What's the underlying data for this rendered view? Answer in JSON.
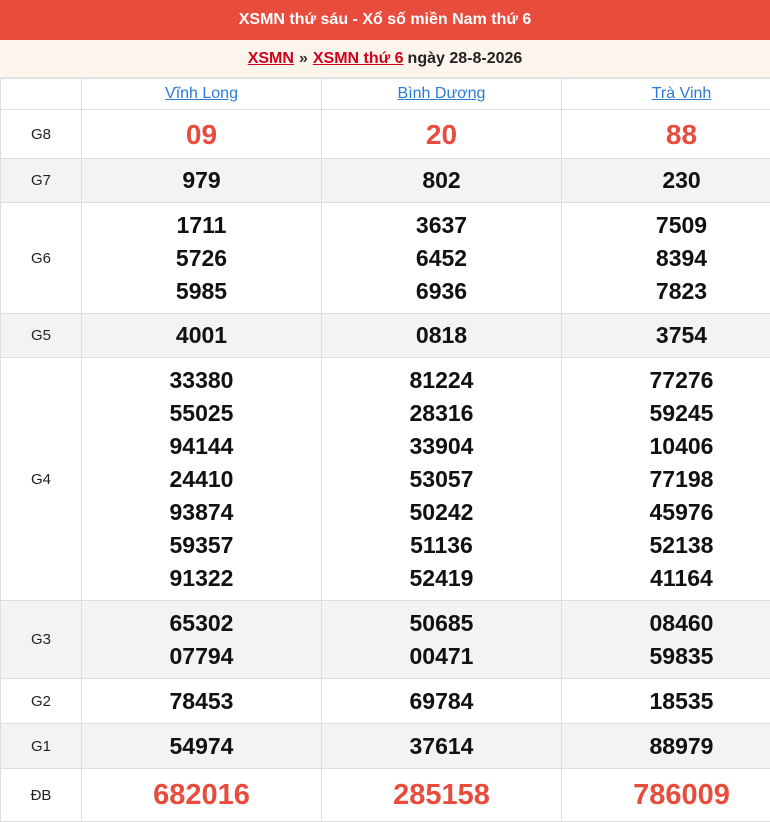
{
  "header": {
    "title": "XSMN thứ sáu - Xổ số miền Nam thứ 6"
  },
  "breadcrumb": {
    "link1": "XSMN",
    "separator": "»",
    "link2": "XSMN thứ 6",
    "date_text": "ngày 28-8-2026"
  },
  "provinces": [
    "Vĩnh Long",
    "Bình Dương",
    "Trà Vinh"
  ],
  "prizes": {
    "g8": {
      "label": "G8",
      "values": [
        [
          "09"
        ],
        [
          "20"
        ],
        [
          "88"
        ]
      ]
    },
    "g7": {
      "label": "G7",
      "values": [
        [
          "979"
        ],
        [
          "802"
        ],
        [
          "230"
        ]
      ]
    },
    "g6": {
      "label": "G6",
      "values": [
        [
          "1711",
          "5726",
          "5985"
        ],
        [
          "3637",
          "6452",
          "6936"
        ],
        [
          "7509",
          "8394",
          "7823"
        ]
      ]
    },
    "g5": {
      "label": "G5",
      "values": [
        [
          "4001"
        ],
        [
          "0818"
        ],
        [
          "3754"
        ]
      ]
    },
    "g4": {
      "label": "G4",
      "values": [
        [
          "33380",
          "55025",
          "94144",
          "24410",
          "93874",
          "59357",
          "91322"
        ],
        [
          "81224",
          "28316",
          "33904",
          "53057",
          "50242",
          "51136",
          "52419"
        ],
        [
          "77276",
          "59245",
          "10406",
          "77198",
          "45976",
          "52138",
          "41164"
        ]
      ]
    },
    "g3": {
      "label": "G3",
      "values": [
        [
          "65302",
          "07794"
        ],
        [
          "50685",
          "00471"
        ],
        [
          "08460",
          "59835"
        ]
      ]
    },
    "g2": {
      "label": "G2",
      "values": [
        [
          "78453"
        ],
        [
          "69784"
        ],
        [
          "18535"
        ]
      ]
    },
    "g1": {
      "label": "G1",
      "values": [
        [
          "54974"
        ],
        [
          "37614"
        ],
        [
          "88979"
        ]
      ]
    },
    "db": {
      "label": "ĐB",
      "values": [
        [
          "682016"
        ],
        [
          "285158"
        ],
        [
          "786009"
        ]
      ]
    }
  }
}
